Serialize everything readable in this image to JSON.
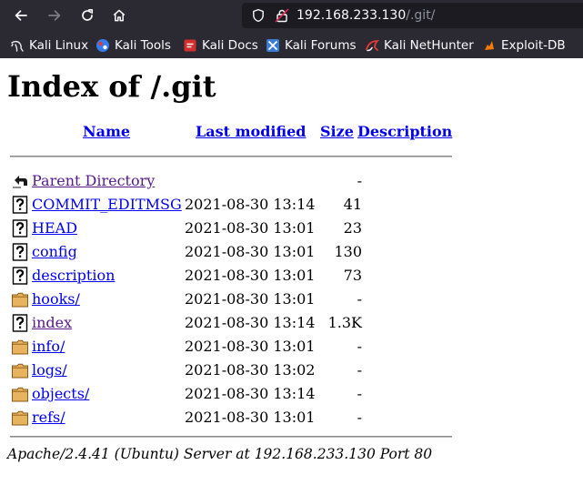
{
  "browser": {
    "url_host": "192.168.233.130",
    "url_path": "/.git/",
    "colors": {
      "chrome_bg": "#2b2a33",
      "urlbar_bg": "#1c1b22",
      "url_text": "#fbfbfe",
      "url_path": "#8f8f9d"
    },
    "bookmarks": [
      {
        "label": "Kali Linux",
        "icon": "kali-dragon-icon"
      },
      {
        "label": "Kali Tools",
        "icon": "kali-tools-icon"
      },
      {
        "label": "Kali Docs",
        "icon": "kali-docs-icon"
      },
      {
        "label": "Kali Forums",
        "icon": "kali-forums-icon"
      },
      {
        "label": "Kali NetHunter",
        "icon": "nethunter-icon"
      },
      {
        "label": "Exploit-DB",
        "icon": "exploit-db-icon"
      }
    ]
  },
  "page": {
    "title": "Index of /.git",
    "columns": {
      "name": "Name",
      "last_modified": "Last modified",
      "size": "Size",
      "description": "Description"
    },
    "rows": [
      {
        "icon": "back-folder-icon",
        "name": "Parent Directory",
        "modified": "",
        "size": "-",
        "visited": true
      },
      {
        "icon": "unknown-file-icon",
        "name": "COMMIT_EDITMSG",
        "modified": "2021-08-30 13:14",
        "size": "41",
        "visited": false
      },
      {
        "icon": "unknown-file-icon",
        "name": "HEAD",
        "modified": "2021-08-30 13:01",
        "size": "23",
        "visited": false
      },
      {
        "icon": "unknown-file-icon",
        "name": "config",
        "modified": "2021-08-30 13:01",
        "size": "130",
        "visited": false
      },
      {
        "icon": "unknown-file-icon",
        "name": "description",
        "modified": "2021-08-30 13:01",
        "size": "73",
        "visited": false
      },
      {
        "icon": "folder-icon",
        "name": "hooks/",
        "modified": "2021-08-30 13:01",
        "size": "-",
        "visited": false
      },
      {
        "icon": "unknown-file-icon",
        "name": "index",
        "modified": "2021-08-30 13:14",
        "size": "1.3K",
        "visited": true
      },
      {
        "icon": "folder-icon",
        "name": "info/",
        "modified": "2021-08-30 13:01",
        "size": "-",
        "visited": false
      },
      {
        "icon": "folder-icon",
        "name": "logs/",
        "modified": "2021-08-30 13:02",
        "size": "-",
        "visited": false
      },
      {
        "icon": "folder-icon",
        "name": "objects/",
        "modified": "2021-08-30 13:14",
        "size": "-",
        "visited": false
      },
      {
        "icon": "folder-icon",
        "name": "refs/",
        "modified": "2021-08-30 13:01",
        "size": "-",
        "visited": false
      }
    ],
    "footer": "Apache/2.4.41 (Ubuntu) Server at 192.168.233.130 Port 80"
  }
}
